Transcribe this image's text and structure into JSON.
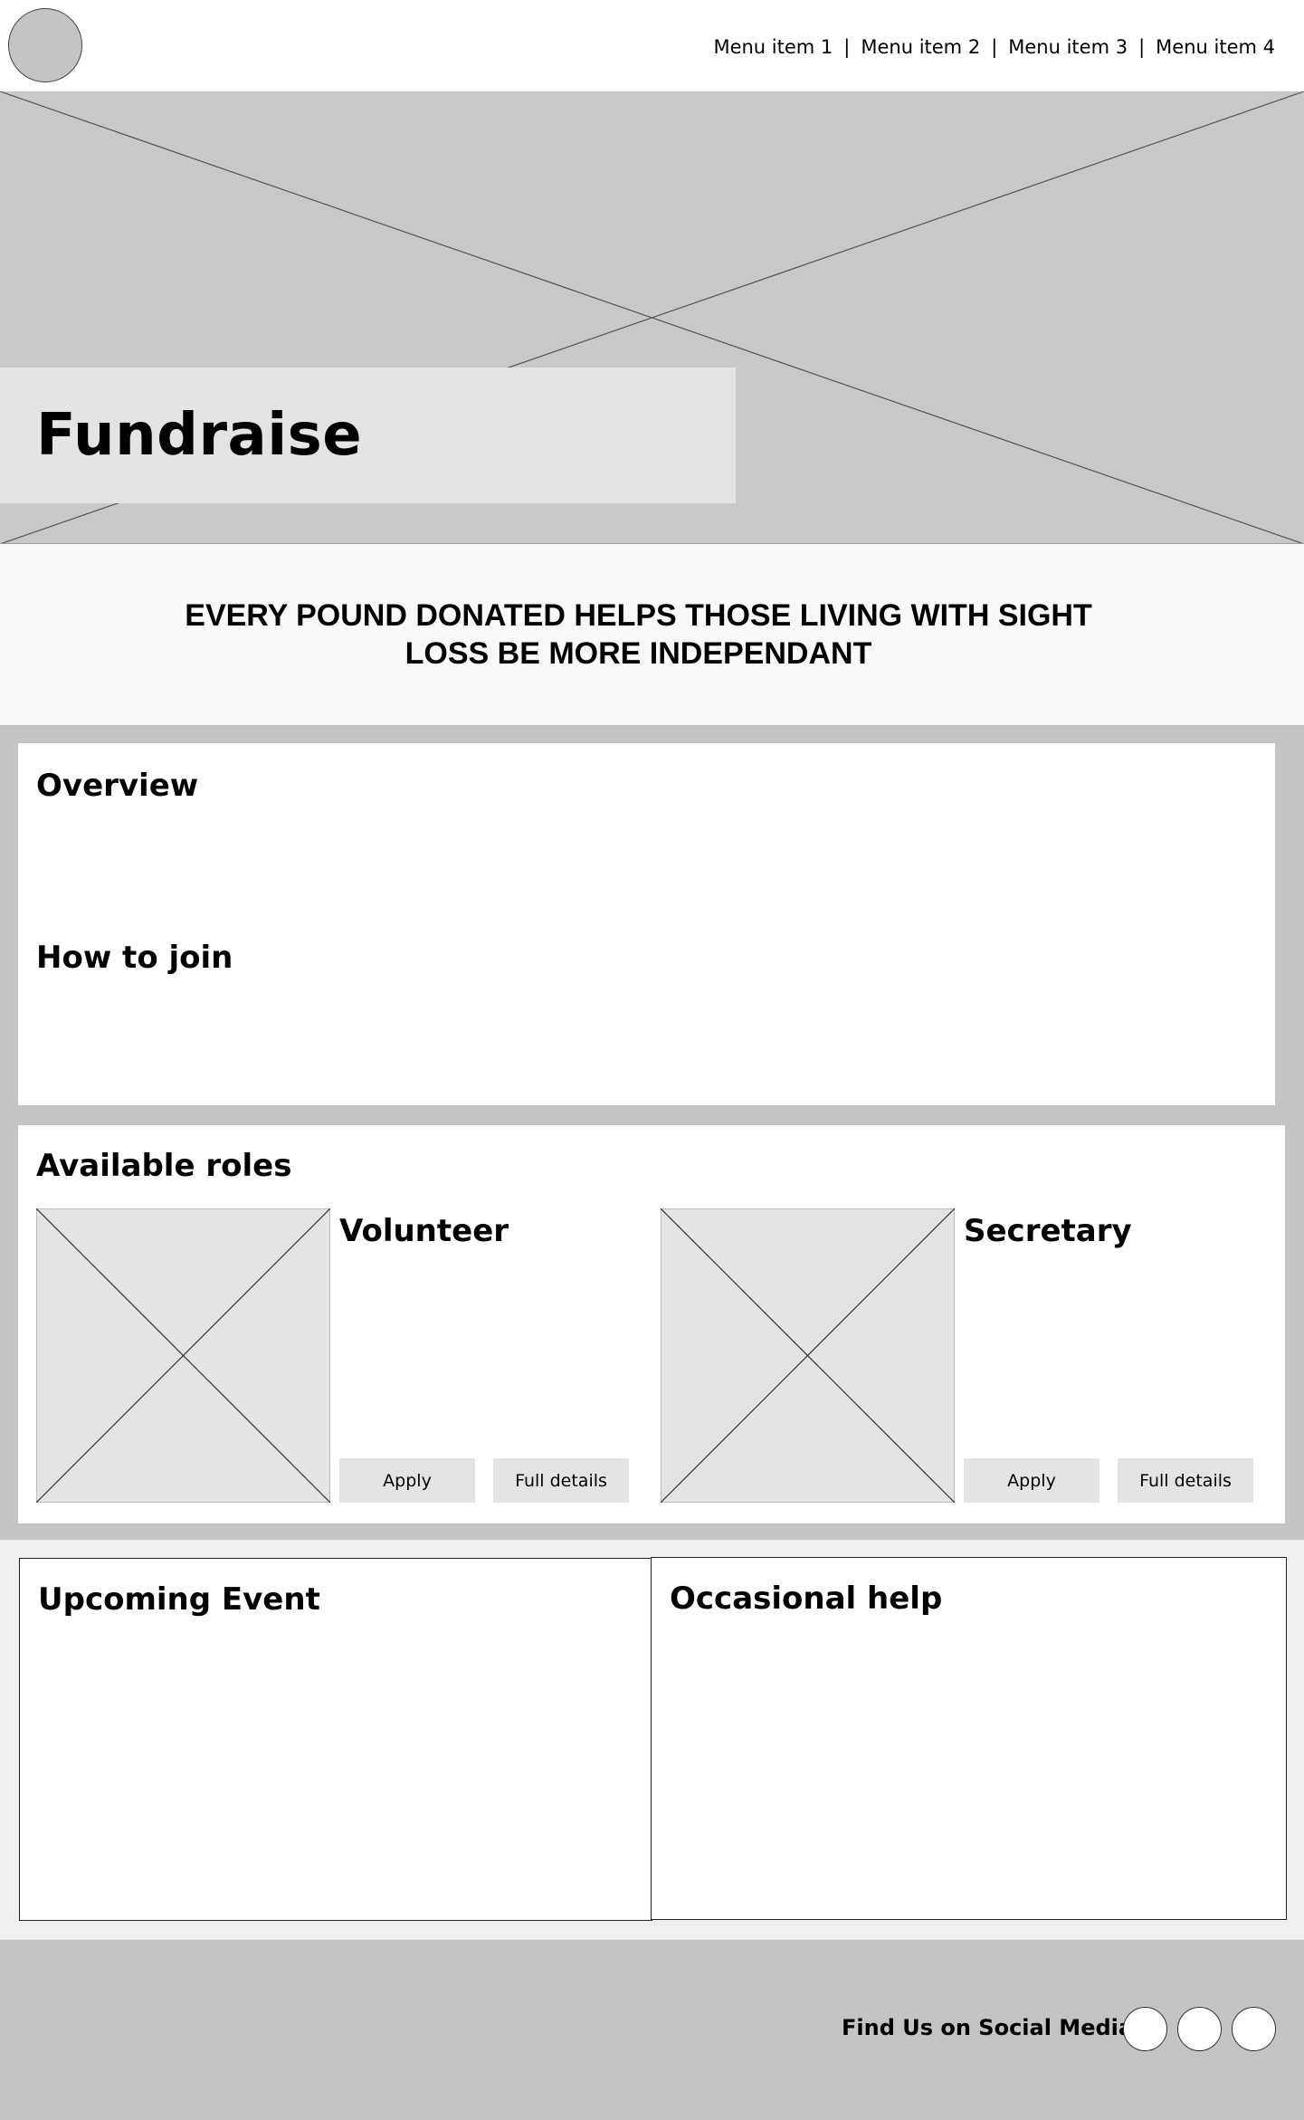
{
  "header": {
    "logo_icon": "circle-logo-placeholder",
    "nav": [
      {
        "label": "Menu item 1"
      },
      {
        "label": "Menu item 2"
      },
      {
        "label": "Menu item 3"
      },
      {
        "label": "Menu item 4"
      }
    ],
    "separator": "|"
  },
  "hero": {
    "title": "Fundraise",
    "image_icon": "image-placeholder-icon"
  },
  "tagline": {
    "line1": "EVERY POUND DONATED HELPS THOSE LIVING WITH SIGHT",
    "line2": "LOSS BE MORE INDEPENDANT"
  },
  "overview": {
    "heading": "Overview",
    "how_to_join_heading": "How to join"
  },
  "roles": {
    "heading": "Available roles",
    "items": [
      {
        "title": "Volunteer",
        "apply_label": "Apply",
        "details_label": "Full details"
      },
      {
        "title": "Secretary",
        "apply_label": "Apply",
        "details_label": "Full details"
      }
    ]
  },
  "events": {
    "upcoming_heading": "Upcoming Event",
    "occasional_heading": "Occasional help"
  },
  "footer": {
    "social_label": "Find Us on Social Media",
    "social_icons": [
      "social-icon-1",
      "social-icon-2",
      "social-icon-3"
    ]
  },
  "colors": {
    "placeholder_grey": "#c9c9c9",
    "light_grey": "#e4e4e4",
    "panel_bg": "#c4c4c4",
    "white": "#ffffff"
  }
}
